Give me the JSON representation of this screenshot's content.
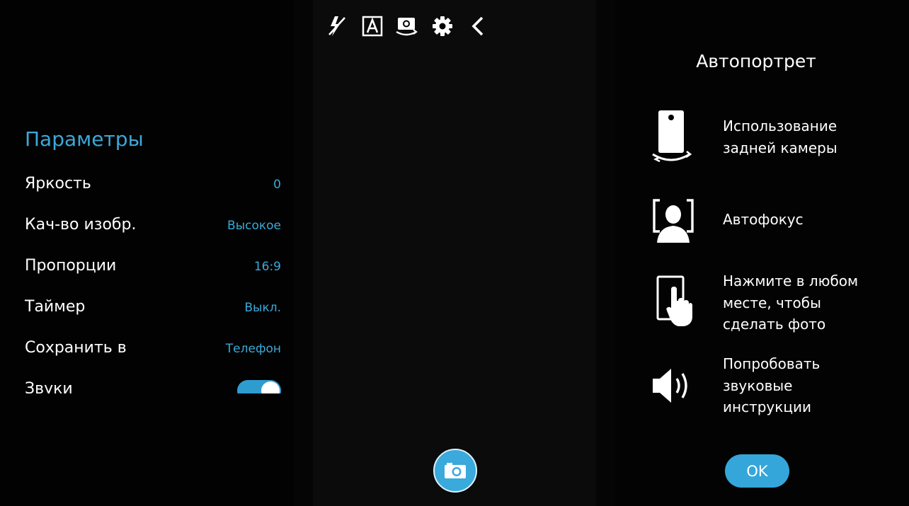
{
  "toolbar": {
    "icons": [
      "flash-off-icon",
      "auto-mode-icon",
      "switch-camera-icon",
      "gear-icon",
      "back-chevron-icon"
    ]
  },
  "settings": {
    "title": "Параметры",
    "items": [
      {
        "label": "Яркость",
        "value": "0"
      },
      {
        "label": "Кач-во изобр.",
        "value": "Высокое"
      },
      {
        "label": "Пропорции",
        "value": "16:9"
      },
      {
        "label": "Таймер",
        "value": "Выкл."
      },
      {
        "label": "Сохранить в",
        "value": "Телефон"
      },
      {
        "label": "Звуки",
        "toggle": "on"
      }
    ]
  },
  "shutter": {
    "icon": "camera-icon"
  },
  "selfie_panel": {
    "title": "Автопортрет",
    "tips": [
      {
        "icon": "rear-camera-icon",
        "text": "Использование\nзадней камеры"
      },
      {
        "icon": "face-focus-icon",
        "text": "Автофокус"
      },
      {
        "icon": "tap-screen-icon",
        "text": "Нажмите в любом\nместе, чтобы\nсделать фото"
      },
      {
        "icon": "speaker-icon",
        "text": "Попробовать\nзвуковые\nинструкции"
      }
    ],
    "ok_label": "OK"
  },
  "colors": {
    "accent": "#3ba9d8",
    "background": "#000000",
    "text": "#ffffff"
  }
}
